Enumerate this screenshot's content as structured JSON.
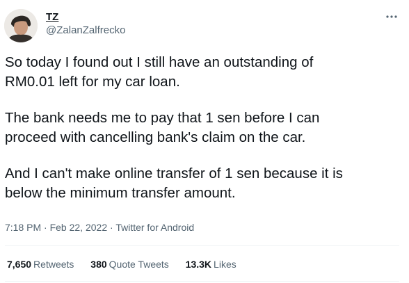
{
  "author": {
    "display_name": "TZ",
    "handle": "@ZalanZalfrecko"
  },
  "more_icon": "more-horizontal-icon",
  "tweet": {
    "paragraphs": [
      "So today I found out I still have an outstanding of\nRM0.01 left for my car loan.",
      "The bank needs me to pay that 1 sen before I can\nproceed with cancelling bank's claim on the car.",
      "And I can't make online transfer of 1 sen because it is\nbelow the minimum transfer amount."
    ]
  },
  "meta": {
    "time": "7:18 PM",
    "separator": "·",
    "date": "Feb 22, 2022",
    "source": "Twitter for Android"
  },
  "stats": {
    "retweets": {
      "count": "7,650",
      "label": "Retweets"
    },
    "quote_tweets": {
      "count": "380",
      "label": "Quote Tweets"
    },
    "likes": {
      "count": "13.3K",
      "label": "Likes"
    }
  },
  "colors": {
    "text": "#0f1419",
    "secondary": "#536471",
    "divider": "#eff3f4"
  }
}
